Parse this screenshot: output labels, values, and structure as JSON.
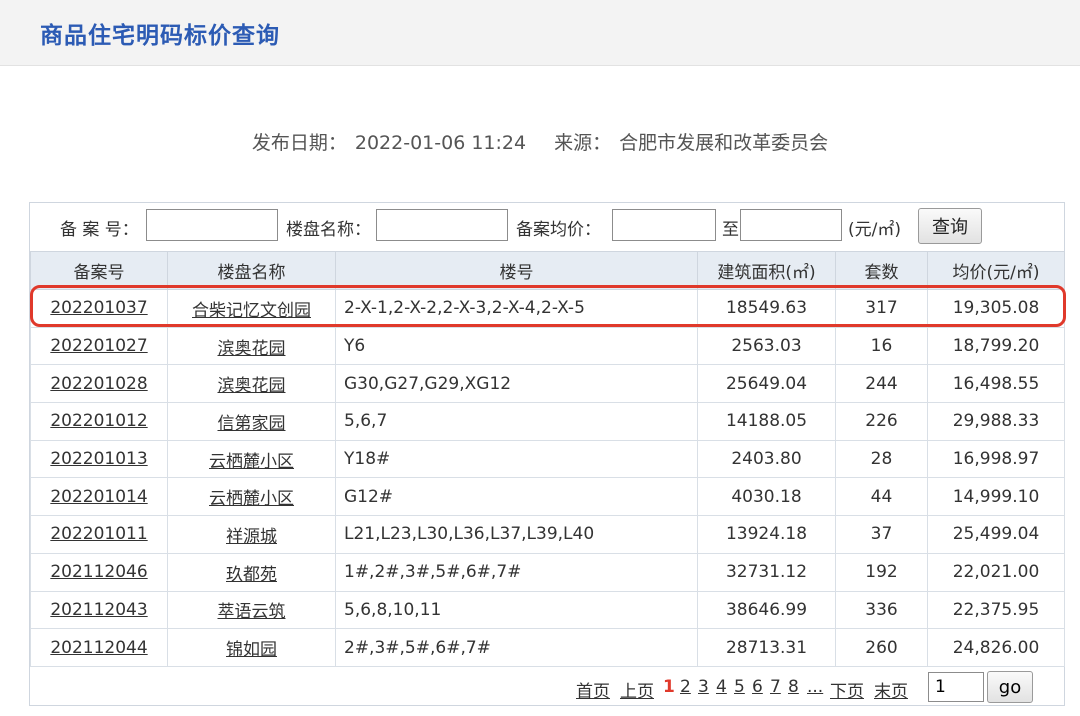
{
  "header": {
    "title": "商品住宅明码标价查询"
  },
  "publish": {
    "date_label": "发布日期：",
    "date_value": "2022-01-06 11:24",
    "source_label": "来源：",
    "source_value": "合肥市发展和改革委员会"
  },
  "search": {
    "record_no_label": "备 案 号：",
    "estate_name_label": "楼盘名称：",
    "avg_price_label": "备案均价：",
    "to_label": "至",
    "unit_label": "(元/㎡)",
    "query_button": "查询"
  },
  "table": {
    "columns": [
      "备案号",
      "楼盘名称",
      "楼号",
      "建筑面积(㎡)",
      "套数",
      "均价(元/㎡)"
    ],
    "rows": [
      {
        "record_no": "202201037",
        "estate": "合柴记忆文创园",
        "buildings": "2-X-1,2-X-2,2-X-3,2-X-4,2-X-5",
        "area": "18549.63",
        "units": "317",
        "avg_price": "19,305.08"
      },
      {
        "record_no": "202201027",
        "estate": "滨奥花园",
        "buildings": "Y6",
        "area": "2563.03",
        "units": "16",
        "avg_price": "18,799.20"
      },
      {
        "record_no": "202201028",
        "estate": "滨奥花园",
        "buildings": "G30,G27,G29,XG12",
        "area": "25649.04",
        "units": "244",
        "avg_price": "16,498.55"
      },
      {
        "record_no": "202201012",
        "estate": "信第家园",
        "buildings": "5,6,7",
        "area": "14188.05",
        "units": "226",
        "avg_price": "29,988.33"
      },
      {
        "record_no": "202201013",
        "estate": "云栖麓小区",
        "buildings": "Y18#",
        "area": "2403.80",
        "units": "28",
        "avg_price": "16,998.97"
      },
      {
        "record_no": "202201014",
        "estate": "云栖麓小区",
        "buildings": "G12#",
        "area": "4030.18",
        "units": "44",
        "avg_price": "14,999.10"
      },
      {
        "record_no": "202201011",
        "estate": "祥源城",
        "buildings": "L21,L23,L30,L36,L37,L39,L40",
        "area": "13924.18",
        "units": "37",
        "avg_price": "25,499.04"
      },
      {
        "record_no": "202112046",
        "estate": "玖都苑",
        "buildings": "1#,2#,3#,5#,6#,7#",
        "area": "32731.12",
        "units": "192",
        "avg_price": "22,021.00"
      },
      {
        "record_no": "202112043",
        "estate": "萃语云筑",
        "buildings": "5,6,8,10,11",
        "area": "38646.99",
        "units": "336",
        "avg_price": "22,375.95"
      },
      {
        "record_no": "202112044",
        "estate": "锦如园",
        "buildings": "2#,3#,5#,6#,7#",
        "area": "28713.31",
        "units": "260",
        "avg_price": "24,826.00"
      }
    ]
  },
  "pager": {
    "first": "首页",
    "prev": "上页",
    "pages": [
      "1",
      "2",
      "3",
      "4",
      "5",
      "6",
      "7",
      "8"
    ],
    "current": "1",
    "ellipsis": "...",
    "next": "下页",
    "last": "末页",
    "input_value": "1",
    "go": "go"
  }
}
